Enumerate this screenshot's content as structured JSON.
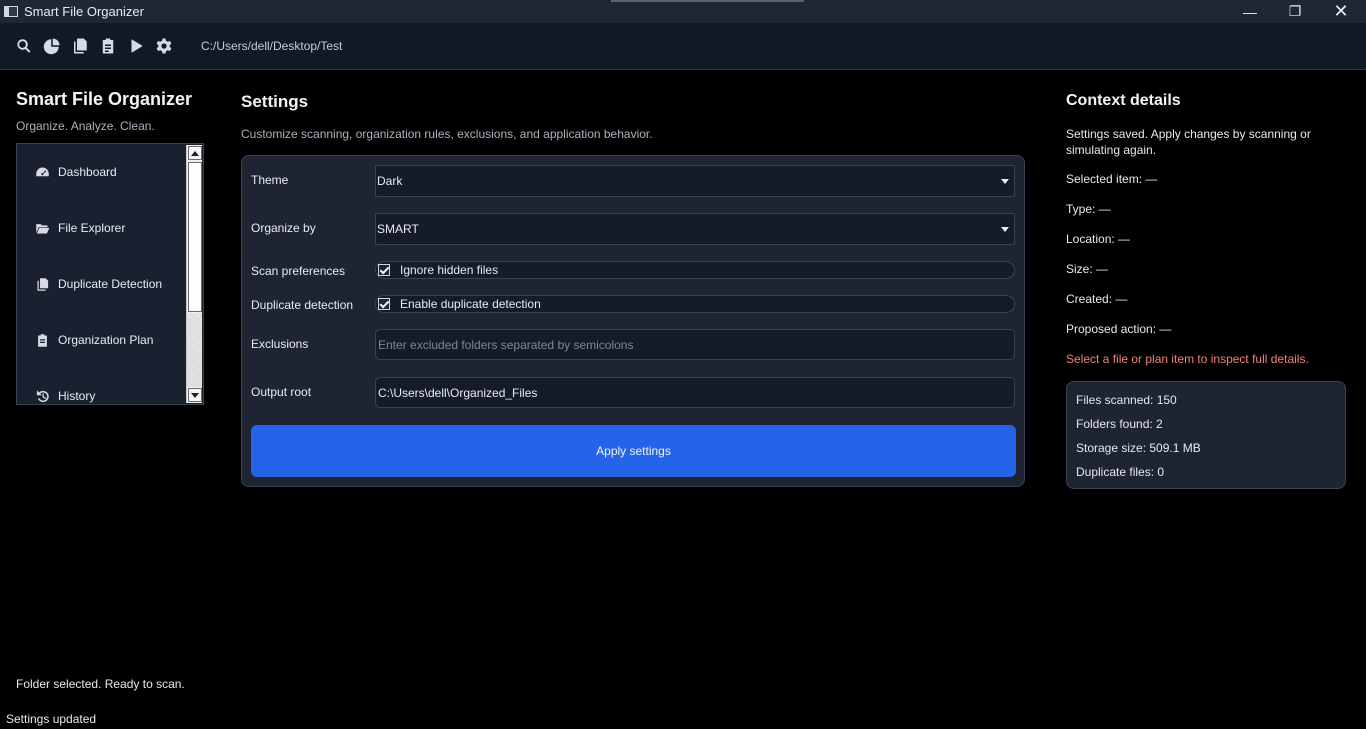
{
  "window": {
    "title": "Smart File Organizer",
    "controls": {
      "minimize": "—",
      "maximize": "❐",
      "close": "✕"
    }
  },
  "toolbar": {
    "icons": [
      "search-icon",
      "pie-chart-icon",
      "copy-icon",
      "clipboard-icon",
      "play-icon",
      "gear-icon"
    ],
    "path": "C:/Users/dell/Desktop/Test"
  },
  "sidebar": {
    "title": "Smart File Organizer",
    "subtitle": "Organize. Analyze. Clean.",
    "items": [
      {
        "label": "Dashboard",
        "icon": "gauge-icon"
      },
      {
        "label": "File Explorer",
        "icon": "folder-open-icon"
      },
      {
        "label": "Duplicate Detection",
        "icon": "copy-icon"
      },
      {
        "label": "Organization Plan",
        "icon": "clipboard-list-icon"
      },
      {
        "label": "History",
        "icon": "history-icon"
      }
    ],
    "status": "Folder selected. Ready to scan."
  },
  "settings": {
    "title": "Settings",
    "subtitle": "Customize scanning, organization rules, exclusions, and application behavior.",
    "theme_label": "Theme",
    "theme_value": "Dark",
    "organize_label": "Organize by",
    "organize_value": "SMART",
    "scan_label": "Scan preferences",
    "scan_option": "Ignore hidden files",
    "scan_checked": true,
    "dup_label": "Duplicate detection",
    "dup_option": "Enable duplicate detection",
    "dup_checked": true,
    "exclusions_label": "Exclusions",
    "exclusions_placeholder": "Enter excluded folders separated by semicolons",
    "output_label": "Output root",
    "output_value": "C:\\Users\\dell\\Organized_Files",
    "apply_label": "Apply settings"
  },
  "context": {
    "title": "Context details",
    "message": "Settings saved. Apply changes by scanning or simulating again.",
    "selected_item": "Selected item: —",
    "type": "Type: —",
    "location": "Location: —",
    "size": "Size: —",
    "created": "Created: —",
    "proposed_action": "Proposed action: —",
    "hint": "Select a file or plan item to inspect full details.",
    "stats": {
      "files_scanned": "Files scanned: 150",
      "folders_found": "Folders found: 2",
      "storage_size": "Storage size: 509.1 MB",
      "duplicate_files": "Duplicate files: 0"
    }
  },
  "statusbar": {
    "text": "Settings updated"
  },
  "colors": {
    "accent": "#2563e8",
    "hint": "#f08078",
    "panel": "#1e2431"
  }
}
